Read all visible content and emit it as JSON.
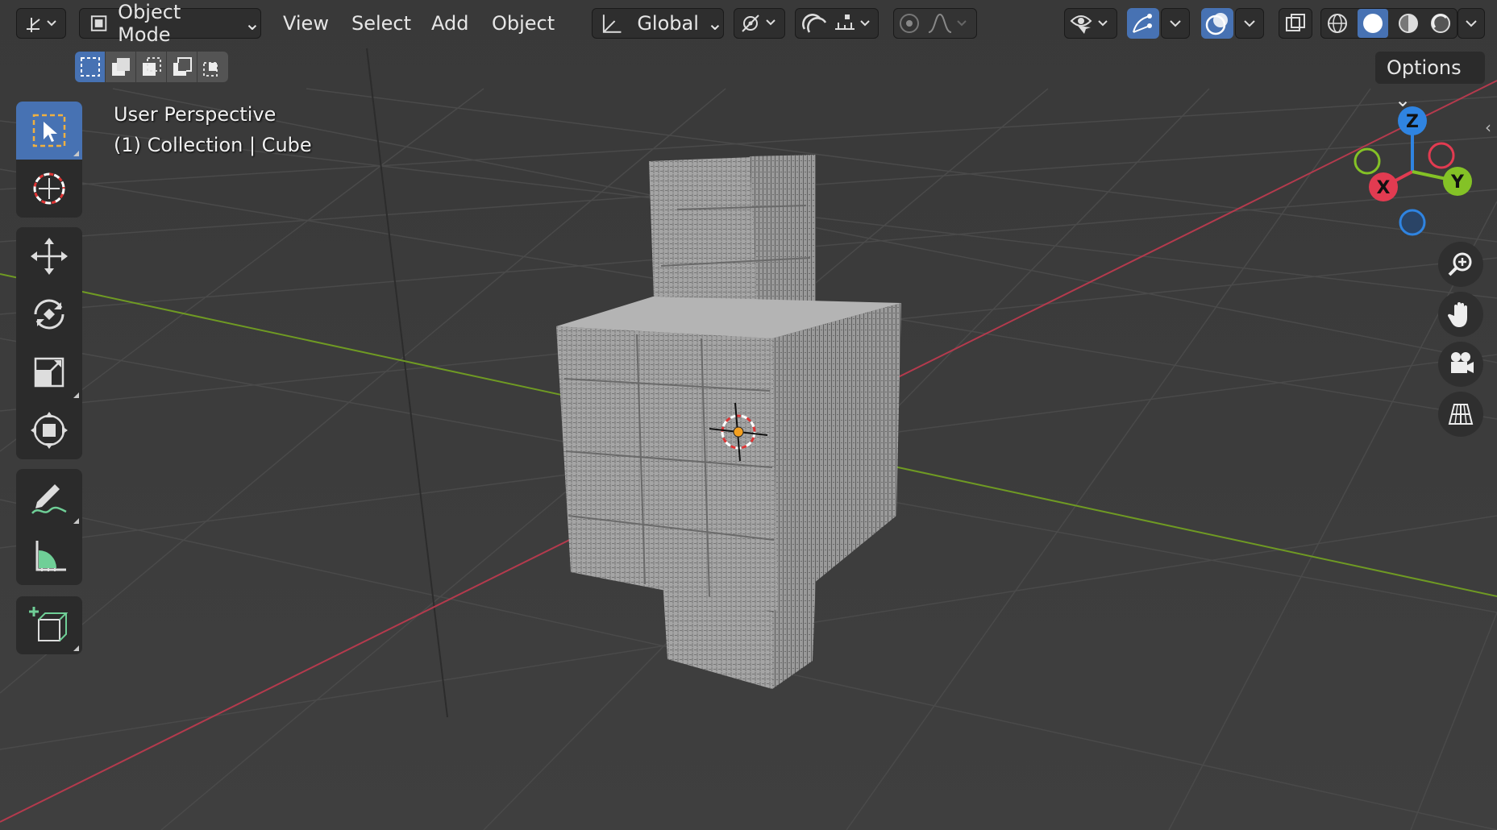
{
  "header": {
    "mode_label": "Object Mode",
    "menus": [
      {
        "id": "view",
        "label": "View"
      },
      {
        "id": "select",
        "label": "Select"
      },
      {
        "id": "add",
        "label": "Add"
      },
      {
        "id": "object",
        "label": "Object"
      }
    ],
    "transform_orientation": "Global",
    "options_label": "Options"
  },
  "viewport": {
    "perspective_label": "User Perspective",
    "collection_label": "(1) Collection | Cube"
  },
  "gizmo": {
    "z_label": "Z",
    "x_label": "X",
    "y_label": "Y",
    "colors": {
      "x": "#e23b51",
      "y": "#84c226",
      "z": "#2f84e1"
    }
  },
  "colors": {
    "accent": "#4772b3",
    "background": "#3d3d3d",
    "x_axis": "#b43a4d",
    "y_axis": "#6f9a23"
  },
  "toolbar": {
    "tools": [
      {
        "name": "select-box-tool",
        "icon": "select-box-icon",
        "active": true
      },
      {
        "name": "cursor-tool",
        "icon": "cursor-icon",
        "active": false
      },
      {
        "name": "move-tool",
        "icon": "move-icon",
        "active": false
      },
      {
        "name": "rotate-tool",
        "icon": "rotate-icon",
        "active": false
      },
      {
        "name": "scale-tool",
        "icon": "scale-icon",
        "active": false
      },
      {
        "name": "transform-tool",
        "icon": "transform-icon",
        "active": false
      },
      {
        "name": "annotate-tool",
        "icon": "annotate-icon",
        "active": false
      },
      {
        "name": "measure-tool",
        "icon": "measure-icon",
        "active": false
      },
      {
        "name": "add-cube-tool",
        "icon": "add-cube-icon",
        "active": false
      }
    ]
  }
}
